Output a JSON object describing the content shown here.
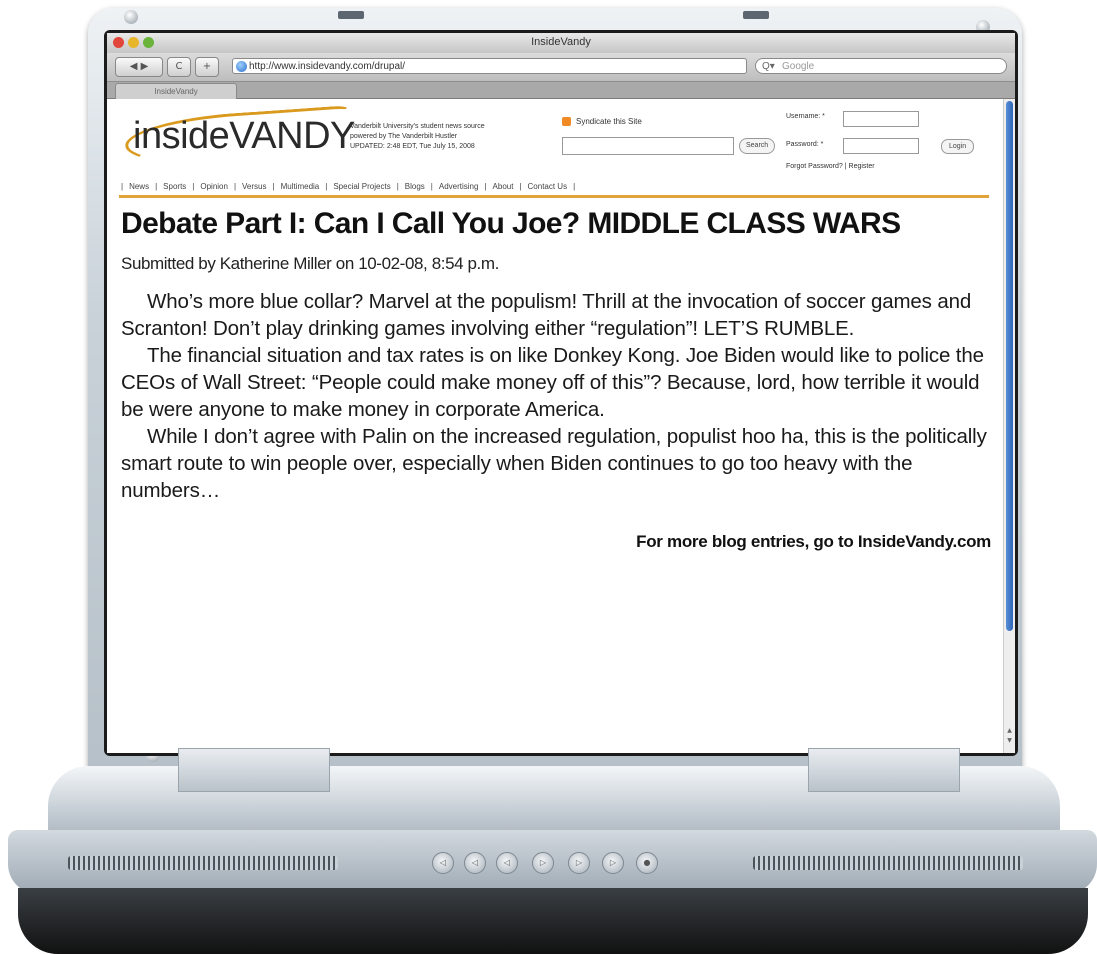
{
  "browser": {
    "window_title": "InsideVandy",
    "url": "http://www.insidevandy.com/drupal/",
    "search_placeholder": "Google",
    "search_prefix": "Q▾",
    "back_label": "◀ ▶",
    "reload_label": "C",
    "add_label": "+",
    "tab_label": "InsideVandy"
  },
  "site": {
    "logo": "insideVANDY",
    "tagline_line1": "Vanderbilt University's student news source",
    "tagline_line2": "powered by The Vanderbilt Hustler",
    "tagline_line3": "UPDATED: 2:48 EDT, Tue July 15, 2008",
    "syndicate": "Syndicate this Site",
    "search_button": "Search",
    "username_label": "Username: *",
    "password_label": "Password: *",
    "login_button": "Login",
    "forgot_password": "Forgot Password?",
    "register": "Register",
    "nav": [
      "News",
      "Sports",
      "Opinion",
      "Versus",
      "Multimedia",
      "Special Projects",
      "Blogs",
      "Advertising",
      "About",
      "Contact Us"
    ]
  },
  "article": {
    "headline": "Debate Part I: Can I Call You Joe? MIDDLE CLASS WARS",
    "byline": "Submitted by Katherine Miller on 10-02-08, 8:54 p.m.",
    "paragraphs": [
      "Who’s more blue collar? Marvel at the populism! Thrill at the invocation of soccer games and Scranton! Don’t play drinking games involving either “regulation”! LET’S RUMBLE.",
      "The financial situation and tax rates is on like Donkey Kong. Joe Biden would like to police the CEOs of Wall Street: “People could make money off of this”? Because, lord, how terrible it would be were anyone to make money in corporate America.",
      "While I don’t agree with Palin on the increased regulation, populist hoo ha, this is the politically smart route to win people over, especially when Biden continues to go too heavy with the numbers…"
    ],
    "more_link": "For more blog entries, go to InsideVandy.com"
  },
  "colors": {
    "accent_orange": "#e2a23a",
    "scroll_blue": "#2f66b8"
  },
  "icons": [
    "globe-icon",
    "search-icon",
    "rss-icon",
    "close-traffic-light",
    "minimize-traffic-light",
    "zoom-traffic-light"
  ]
}
